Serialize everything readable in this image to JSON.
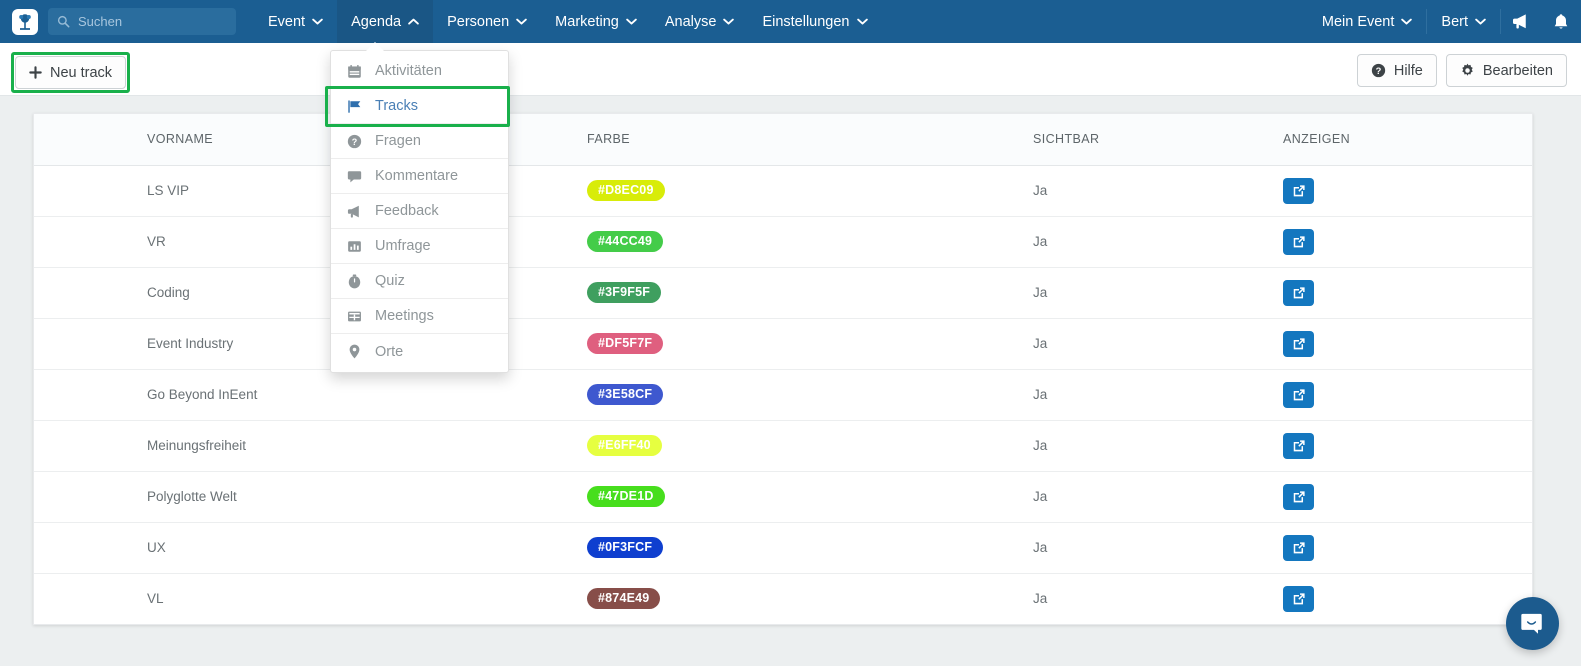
{
  "navbar": {
    "logo_icon": "app-logo-icon",
    "search": {
      "placeholder": "Suchen",
      "value": "",
      "icon": "search-icon"
    },
    "items": [
      {
        "label": "Event",
        "caret": "chevron-down-icon",
        "active": false
      },
      {
        "label": "Agenda",
        "caret": "chevron-up-icon",
        "active": true
      },
      {
        "label": "Personen",
        "caret": "chevron-down-icon",
        "active": false
      },
      {
        "label": "Marketing",
        "caret": "chevron-down-icon",
        "active": false
      },
      {
        "label": "Analyse",
        "caret": "chevron-down-icon",
        "active": false
      },
      {
        "label": "Einstellungen",
        "caret": "chevron-down-icon",
        "active": false
      }
    ],
    "right_items": [
      {
        "label": "Mein Event",
        "caret": "chevron-down-icon"
      },
      {
        "label": "Bert",
        "caret": "chevron-down-icon"
      }
    ],
    "megaphone_icon": "megaphone-icon",
    "bell_icon": "bell-icon",
    "background_color": "#1b5e92"
  },
  "dropdown": {
    "open_for": "Agenda",
    "highlight_color": "#19b04b",
    "items": [
      {
        "label": "Aktivitäten",
        "icon": "calendar-icon",
        "highlighted": false
      },
      {
        "label": "Tracks",
        "icon": "flag-icon",
        "highlighted": true
      },
      {
        "label": "Fragen",
        "icon": "question-circle-icon",
        "highlighted": false
      },
      {
        "label": "Kommentare",
        "icon": "comment-icon",
        "highlighted": false
      },
      {
        "label": "Feedback",
        "icon": "megaphone-icon",
        "highlighted": false
      },
      {
        "label": "Umfrage",
        "icon": "bar-chart-icon",
        "highlighted": false
      },
      {
        "label": "Quiz",
        "icon": "stopwatch-icon",
        "highlighted": false
      },
      {
        "label": "Meetings",
        "icon": "table-icon",
        "highlighted": false
      },
      {
        "label": "Orte",
        "icon": "map-pin-icon",
        "highlighted": false
      }
    ]
  },
  "toolbar": {
    "new_track_label": "Neu track",
    "new_track_icon": "plus-icon",
    "new_track_highlighted": true,
    "help_label": "Hilfe",
    "help_icon": "question-circle-icon",
    "edit_label": "Bearbeiten",
    "edit_icon": "gear-icon"
  },
  "table": {
    "columns": [
      "VORNAME",
      "FARBE",
      "SICHTBAR",
      "ANZEIGEN"
    ],
    "rows": [
      {
        "name": "LS VIP",
        "color": "#D8EC09",
        "visible": "Ja",
        "action_icon": "external-link-icon"
      },
      {
        "name": "VR",
        "color": "#44CC49",
        "visible": "Ja",
        "action_icon": "external-link-icon"
      },
      {
        "name": "Coding",
        "color": "#3F9F5F",
        "visible": "Ja",
        "action_icon": "external-link-icon"
      },
      {
        "name": "Event Industry",
        "color": "#DF5F7F",
        "visible": "Ja",
        "action_icon": "external-link-icon"
      },
      {
        "name": "Go Beyond InEent",
        "color": "#3E58CF",
        "visible": "Ja",
        "action_icon": "external-link-icon"
      },
      {
        "name": "Meinungsfreiheit",
        "color": "#E6FF40",
        "visible": "Ja",
        "action_icon": "external-link-icon"
      },
      {
        "name": "Polyglotte Welt",
        "color": "#47DE1D",
        "visible": "Ja",
        "action_icon": "external-link-icon"
      },
      {
        "name": "UX",
        "color": "#0F3FCF",
        "visible": "Ja",
        "action_icon": "external-link-icon"
      },
      {
        "name": "VL",
        "color": "#874E49",
        "visible": "Ja",
        "action_icon": "external-link-icon"
      }
    ]
  },
  "chat": {
    "icon": "chat-bubble-icon",
    "color": "#1c5b8e"
  }
}
